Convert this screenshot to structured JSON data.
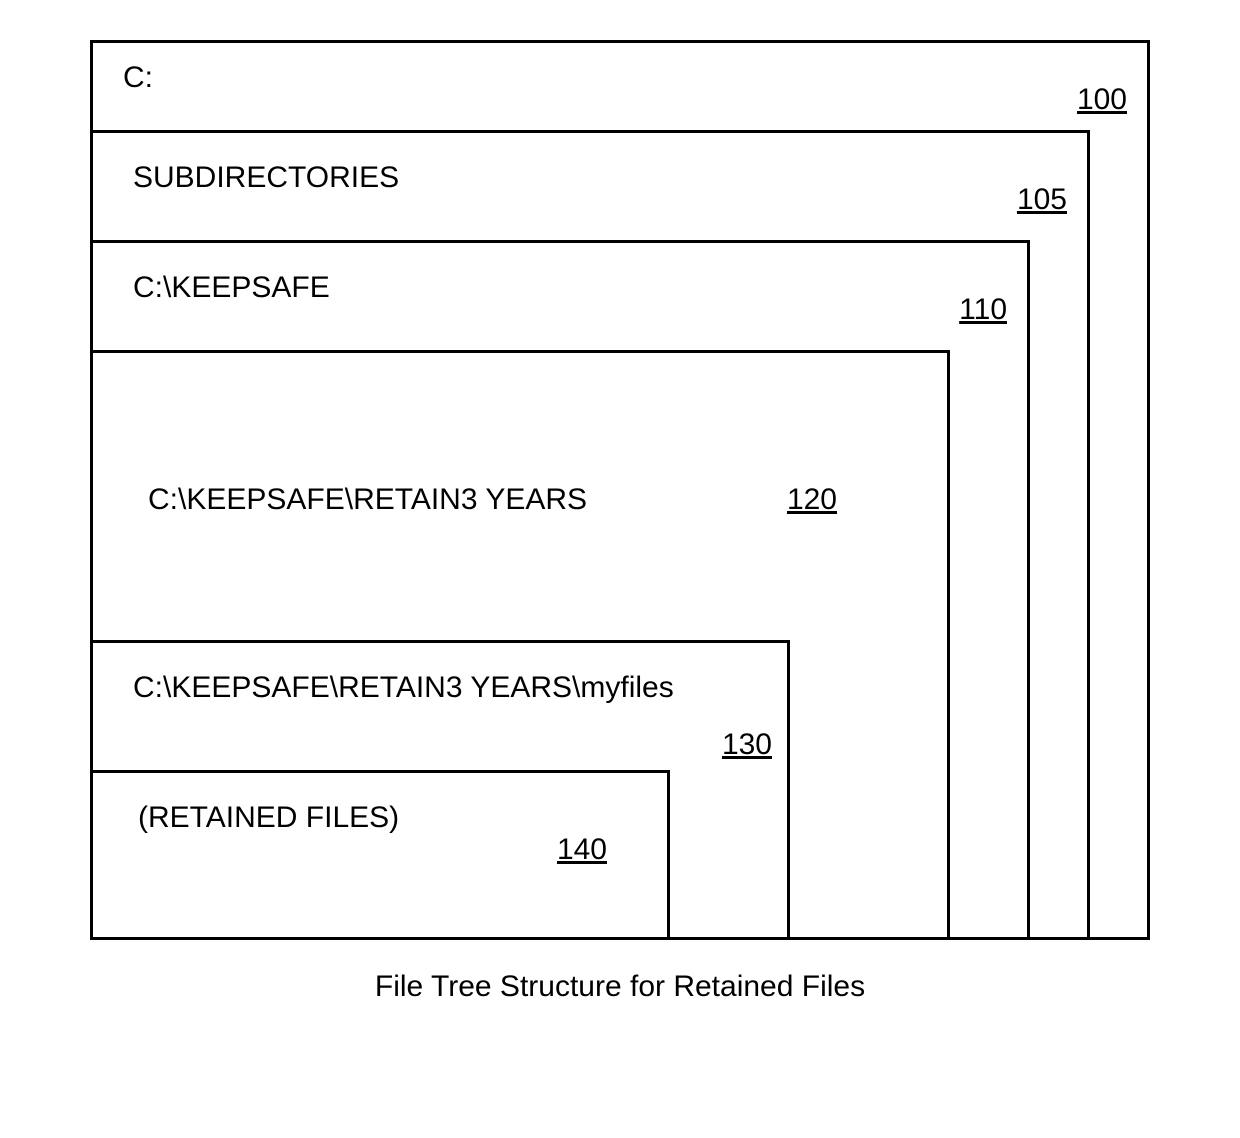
{
  "caption": "File Tree Structure for Retained Files",
  "boxes": {
    "b100": {
      "label": "C:",
      "ref": "100"
    },
    "b105": {
      "label": "SUBDIRECTORIES",
      "ref": "105"
    },
    "b110": {
      "label": "C:\\KEEPSAFE",
      "ref": "110"
    },
    "b120": {
      "label": "C:\\KEEPSAFE\\RETAIN3 YEARS",
      "ref": "120"
    },
    "b130": {
      "label": "C:\\KEEPSAFE\\RETAIN3 YEARS\\myfiles",
      "ref": "130"
    },
    "b140": {
      "label": "(RETAINED FILES)",
      "ref": "140"
    }
  }
}
